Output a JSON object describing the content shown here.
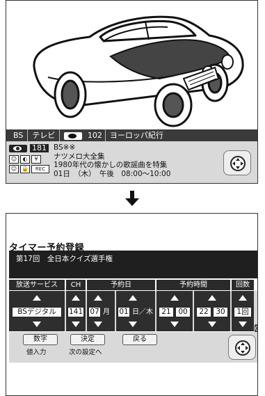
{
  "channel_bar": {
    "network": "BS",
    "network_type": "テレビ",
    "channel_number": "102",
    "program_name": "ヨーロッパ紀行"
  },
  "program_info": {
    "channel_number": "181",
    "lines": [
      "BS※※",
      "ナツメロ大全集",
      "1980年代の懐かしの歌謡曲を特集",
      "01日　（木）　午後　08:00〜10:00"
    ],
    "icons": [
      "☺",
      "◐",
      "¥",
      "☺",
      "🔒",
      "REC"
    ]
  },
  "timer": {
    "title": "タイマー予約登録",
    "program": "第17回　全日本クイズ選手権",
    "headers": {
      "service": "放送サービス",
      "ch": "CH",
      "date": "予約日",
      "time": "予約時間",
      "count": "回数"
    },
    "values": {
      "service": "BSデジタル",
      "ch": "141",
      "month": "07",
      "month_unit": "月",
      "day": "01",
      "day_unit": "日／木",
      "start_h": "21",
      "start_m": "00",
      "end_h": "22",
      "end_m": "30",
      "count": "1回"
    },
    "ok_label": "OK",
    "buttons": [
      {
        "label": "数字",
        "caption": "値入力"
      },
      {
        "label": "決定",
        "caption": "次の設定へ"
      },
      {
        "label": "戻る",
        "caption": ""
      }
    ]
  }
}
